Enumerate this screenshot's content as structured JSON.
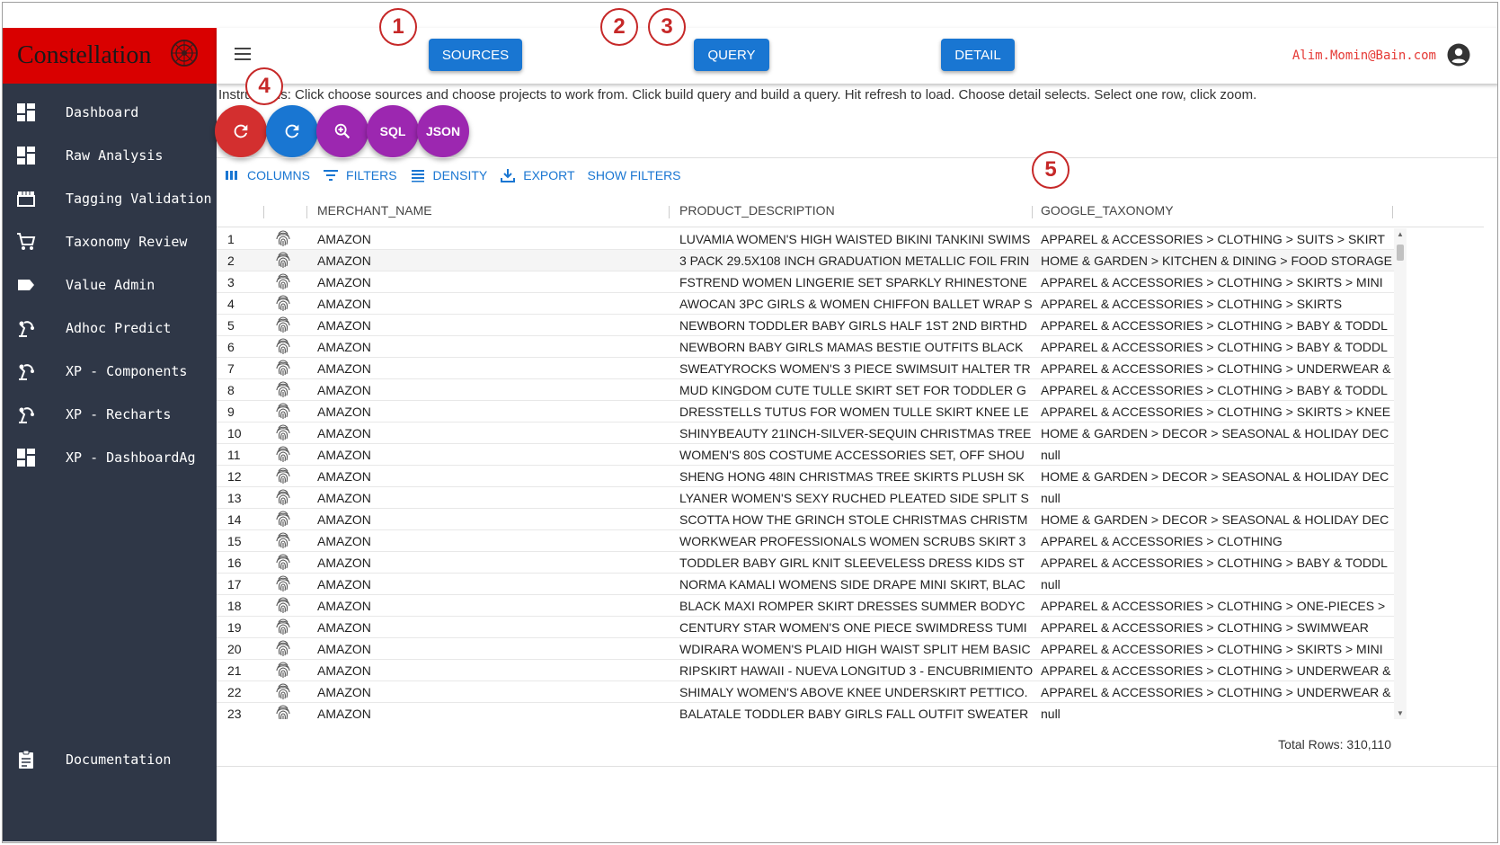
{
  "brand": {
    "title": "Constellation"
  },
  "sidebar": {
    "items": [
      {
        "label": "Dashboard",
        "icon": "dashboard-icon"
      },
      {
        "label": "Raw Analysis",
        "icon": "dashboard-icon"
      },
      {
        "label": "Tagging Validation",
        "icon": "store-icon"
      },
      {
        "label": "Taxonomy Review",
        "icon": "cart-icon"
      },
      {
        "label": "Value Admin",
        "icon": "label-icon"
      },
      {
        "label": "Adhoc Predict",
        "icon": "precision-icon"
      },
      {
        "label": "XP - Components",
        "icon": "precision-icon"
      },
      {
        "label": "XP - Recharts",
        "icon": "precision-icon"
      },
      {
        "label": "XP - DashboardAg",
        "icon": "dashboard-icon"
      }
    ],
    "documentation": {
      "label": "Documentation",
      "icon": "assignment-icon"
    }
  },
  "topbar": {
    "sources_label": "SOURCES",
    "query_label": "QUERY",
    "detail_label": "DETAIL",
    "user_email": "Alim.Momin@Bain.com"
  },
  "instructions": "Instructions: Click choose sources and choose projects to work from. Click build query and build a query. Hit refresh to load. Choose detail selects. Select one row, click zoom.",
  "actions": {
    "sql_label": "SQL",
    "json_label": "JSON"
  },
  "toolbar": {
    "columns": "COLUMNS",
    "filters": "FILTERS",
    "density": "DENSITY",
    "export": "EXPORT",
    "show_filters": "SHOW FILTERS"
  },
  "grid": {
    "headers": [
      "MERCHANT_NAME",
      "PRODUCT_DESCRIPTION",
      "GOOGLE_TAXONOMY"
    ],
    "rows": [
      [
        "1",
        "AMAZON",
        "LUVAMIA WOMEN'S HIGH WAISTED BIKINI TANKINI SWIMS",
        "APPAREL & ACCESSORIES > CLOTHING > SUITS > SKIRT"
      ],
      [
        "2",
        "AMAZON",
        "3 PACK 29.5X108 INCH GRADUATION METALLIC FOIL FRIN",
        "HOME & GARDEN > KITCHEN & DINING > FOOD STORAGE"
      ],
      [
        "3",
        "AMAZON",
        "FSTREND WOMEN LINGERIE SET SPARKLY RHINESTONE",
        "APPAREL & ACCESSORIES > CLOTHING > SKIRTS > MINI"
      ],
      [
        "4",
        "AMAZON",
        "AWOCAN 3PC GIRLS & WOMEN CHIFFON BALLET WRAP S",
        "APPAREL & ACCESSORIES > CLOTHING > SKIRTS"
      ],
      [
        "5",
        "AMAZON",
        "NEWBORN TODDLER BABY GIRLS HALF 1ST 2ND BIRTHD",
        "APPAREL & ACCESSORIES > CLOTHING > BABY & TODDL"
      ],
      [
        "6",
        "AMAZON",
        "NEWBORN BABY GIRLS MAMAS BESTIE OUTFITS BLACK",
        "APPAREL & ACCESSORIES > CLOTHING > BABY & TODDL"
      ],
      [
        "7",
        "AMAZON",
        "SWEATYROCKS WOMEN'S 3 PIECE SWIMSUIT HALTER TR",
        "APPAREL & ACCESSORIES > CLOTHING > UNDERWEAR &"
      ],
      [
        "8",
        "AMAZON",
        "MUD KINGDOM CUTE TULLE SKIRT SET FOR TODDLER G",
        "APPAREL & ACCESSORIES > CLOTHING > BABY & TODDL"
      ],
      [
        "9",
        "AMAZON",
        "DRESSTELLS TUTUS FOR WOMEN TULLE SKIRT KNEE LE",
        "APPAREL & ACCESSORIES > CLOTHING > SKIRTS > KNEE"
      ],
      [
        "10",
        "AMAZON",
        "SHINYBEAUTY 21INCH-SILVER-SEQUIN CHRISTMAS TREE",
        "HOME & GARDEN > DECOR > SEASONAL & HOLIDAY DEC"
      ],
      [
        "11",
        "AMAZON",
        "WOMEN'S 80S COSTUME ACCESSORIES SET, OFF SHOU",
        "null"
      ],
      [
        "12",
        "AMAZON",
        "SHENG HONG 48IN CHRISTMAS TREE SKIRTS PLUSH SK",
        "HOME & GARDEN > DECOR > SEASONAL & HOLIDAY DEC"
      ],
      [
        "13",
        "AMAZON",
        "LYANER WOMEN'S SEXY RUCHED PLEATED SIDE SPLIT S",
        "null"
      ],
      [
        "14",
        "AMAZON",
        "SCOTTA HOW THE GRINCH STOLE CHRISTMAS CHRISTM",
        "HOME & GARDEN > DECOR > SEASONAL & HOLIDAY DEC"
      ],
      [
        "15",
        "AMAZON",
        "WORKWEAR PROFESSIONALS WOMEN SCRUBS SKIRT 3",
        "APPAREL & ACCESSORIES > CLOTHING"
      ],
      [
        "16",
        "AMAZON",
        "TODDLER BABY GIRL KNIT SLEEVELESS DRESS KIDS ST",
        "APPAREL & ACCESSORIES > CLOTHING > BABY & TODDL"
      ],
      [
        "17",
        "AMAZON",
        "NORMA KAMALI WOMENS SIDE DRAPE MINI SKIRT, BLAC",
        "null"
      ],
      [
        "18",
        "AMAZON",
        "BLACK MAXI ROMPER SKIRT DRESSES SUMMER BODYC",
        "APPAREL & ACCESSORIES > CLOTHING > ONE-PIECES >"
      ],
      [
        "19",
        "AMAZON",
        "CENTURY STAR WOMEN'S ONE PIECE SWIMDRESS TUMI",
        "APPAREL & ACCESSORIES > CLOTHING > SWIMWEAR"
      ],
      [
        "20",
        "AMAZON",
        "WDIRARA WOMEN'S PLAID HIGH WAIST SPLIT HEM BASIC",
        "APPAREL & ACCESSORIES > CLOTHING > SKIRTS > MINI"
      ],
      [
        "21",
        "AMAZON",
        "RIPSKIRT HAWAII - NUEVA LONGITUD 3 - ENCUBRIMIENTO",
        "APPAREL & ACCESSORIES > CLOTHING > UNDERWEAR &"
      ],
      [
        "22",
        "AMAZON",
        "SHIMALY WOMEN'S ABOVE KNEE UNDERSKIRT PETTICO.",
        "APPAREL & ACCESSORIES > CLOTHING > UNDERWEAR &"
      ],
      [
        "23",
        "AMAZON",
        "BALATALE TODDLER BABY GIRLS FALL OUTFIT SWEATER",
        "null"
      ]
    ],
    "total_rows": "Total Rows: 310,110"
  },
  "callouts": [
    "1",
    "2",
    "3",
    "4",
    "5"
  ],
  "colors": {
    "brand_red": "#d90000",
    "sidebar_bg": "#2f3747",
    "primary_blue": "#1976d2",
    "refresh_red": "#d32f2f",
    "purple": "#9c27b0",
    "callout_red": "#c62828"
  }
}
